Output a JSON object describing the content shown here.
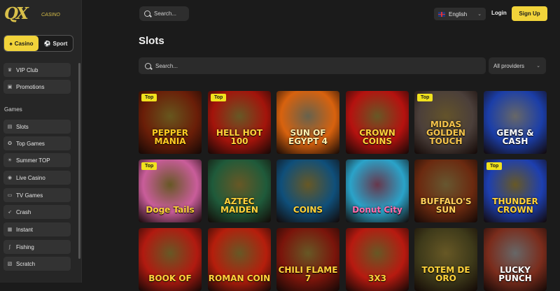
{
  "brand": {
    "logo_mark": "QX",
    "logo_sub": "CASINO"
  },
  "switch": {
    "casino": "Casino",
    "sport": "Sport"
  },
  "sidebar": {
    "top_items": [
      {
        "label": "VIP Club",
        "icon": "crown-icon"
      },
      {
        "label": "Promotions",
        "icon": "gift-icon"
      }
    ],
    "section": "Games",
    "game_items": [
      {
        "label": "Slots",
        "icon": "slot-icon"
      },
      {
        "label": "Top Games",
        "icon": "star-icon"
      },
      {
        "label": "Summer TOP",
        "icon": "sun-icon"
      },
      {
        "label": "Live Casino",
        "icon": "live-icon"
      },
      {
        "label": "TV Games",
        "icon": "tv-icon"
      },
      {
        "label": "Crash",
        "icon": "rocket-icon"
      },
      {
        "label": "Instant",
        "icon": "bolt-icon"
      },
      {
        "label": "Fishing",
        "icon": "fish-icon"
      },
      {
        "label": "Scratch",
        "icon": "scratch-icon"
      }
    ]
  },
  "header": {
    "search_placeholder": "Search...",
    "language": "English",
    "login": "Login",
    "signup": "Sign Up"
  },
  "main": {
    "title": "Slots",
    "search_placeholder": "Search...",
    "providers": "All providers",
    "badge": "Top",
    "games": [
      {
        "name": "PEPPER MANIA",
        "top": true,
        "bg": "#6a1e08",
        "color": "#ffcc22"
      },
      {
        "name": "HELL HOT 100",
        "top": true,
        "bg": "#a3140b",
        "color": "#ffd23a"
      },
      {
        "name": "SUN OF EGYPT 4",
        "top": false,
        "bg": "#d8620e",
        "color": "#fff1b0"
      },
      {
        "name": "CROWN COINS",
        "top": false,
        "bg": "#b5120f",
        "color": "#ffd23a"
      },
      {
        "name": "MIDAS GOLDEN TOUCH",
        "top": true,
        "bg": "#4b3f3a",
        "color": "#f4c34a"
      },
      {
        "name": "GEMS & CASH",
        "top": false,
        "bg": "#1b3ea8",
        "color": "#ffffff"
      },
      {
        "name": "Doge Tails",
        "top": true,
        "bg": "#c95d9a",
        "color": "#ffd23a"
      },
      {
        "name": "AZTEC MAIDEN",
        "top": false,
        "bg": "#1f5a3a",
        "color": "#ffd23a"
      },
      {
        "name": "COINS",
        "top": false,
        "bg": "#0f4f7a",
        "color": "#ffd23a"
      },
      {
        "name": "Donut City",
        "top": false,
        "bg": "#2aa3c9",
        "color": "#ff6fae"
      },
      {
        "name": "BUFFALO'S SUN",
        "top": false,
        "bg": "#6b2a10",
        "color": "#ffcf5a"
      },
      {
        "name": "THUNDER CROWN",
        "top": true,
        "bg": "#1d3fb0",
        "color": "#ffd23a"
      },
      {
        "name": "BOOK OF",
        "top": false,
        "bg": "#b11a10",
        "color": "#ffd23a"
      },
      {
        "name": "ROMAN COIN",
        "top": false,
        "bg": "#b51e0c",
        "color": "#ffd23a"
      },
      {
        "name": "CHILI FLAME 7",
        "top": false,
        "bg": "#7a150b",
        "color": "#ffd23a"
      },
      {
        "name": "3X3",
        "top": false,
        "bg": "#b71a10",
        "color": "#ffd23a"
      },
      {
        "name": "TOTEM DE ORO",
        "top": false,
        "bg": "#3e3a1a",
        "color": "#ffd23a"
      },
      {
        "name": "LUCKY PUNCH",
        "top": false,
        "bg": "#7a2c1c",
        "color": "#ffffff"
      }
    ]
  }
}
